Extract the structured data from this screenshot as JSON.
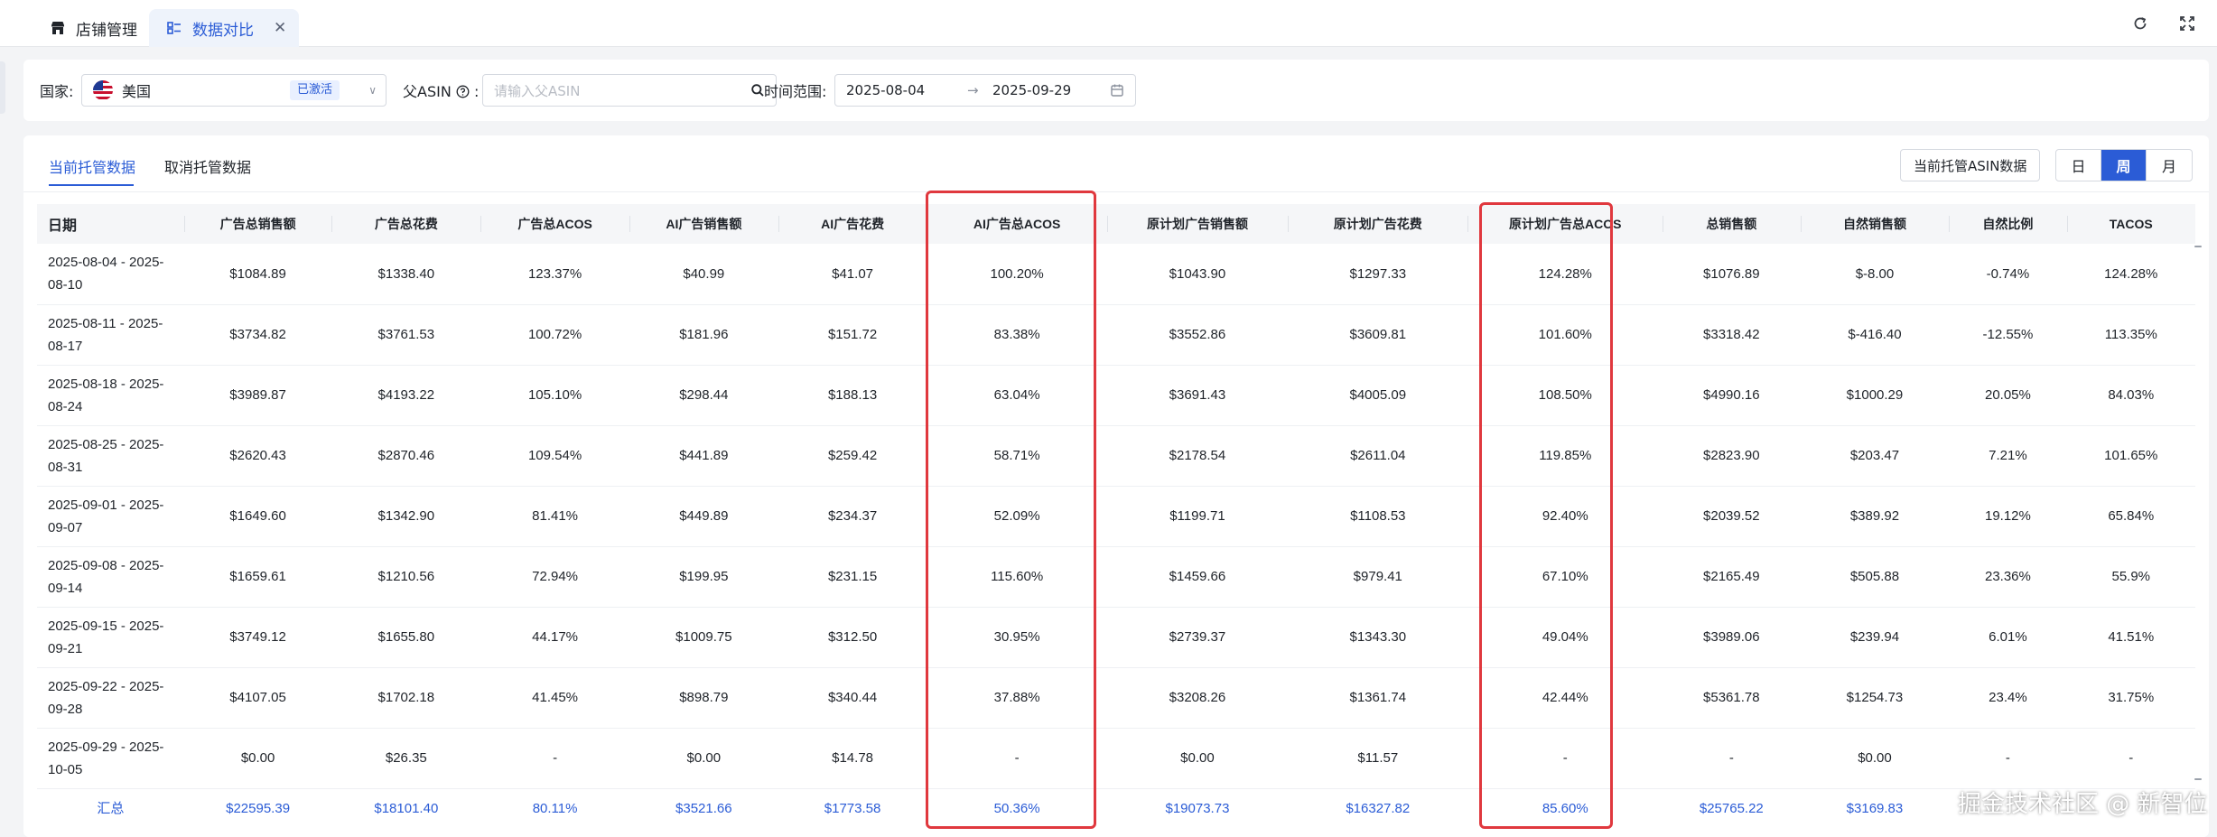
{
  "tabs": [
    {
      "label": "店铺管理",
      "icon": "store-icon",
      "active": false
    },
    {
      "label": "数据对比",
      "icon": "data-compare-icon",
      "active": true
    }
  ],
  "filters": {
    "country_label": "国家:",
    "country_value": "美国",
    "country_status": "已激活",
    "asin_label": "父ASIN",
    "asin_placeholder": "请输入父ASIN",
    "time_label": "时间范围:",
    "date_start": "2025-08-04",
    "date_end": "2025-09-29"
  },
  "subtabs": {
    "current": "当前托管数据",
    "cancelled": "取消托管数据"
  },
  "toolbar": {
    "asin_button": "当前托管ASIN数据",
    "periods": [
      "日",
      "周",
      "月"
    ],
    "active_period": "周"
  },
  "table": {
    "headers": [
      "日期",
      "广告总销售额",
      "广告总花费",
      "广告总ACOS",
      "AI广告销售额",
      "AI广告花费",
      "AI广告总ACOS",
      "原计划广告销售额",
      "原计划广告花费",
      "原计划广告总ACOS",
      "总销售额",
      "自然销售额",
      "自然比例",
      "TACOS"
    ],
    "rows": [
      {
        "date_a": "2025-08-04 - 2025-",
        "date_b": "08-10",
        "cells": [
          "$1084.89",
          "$1338.40",
          "123.37%",
          "$40.99",
          "$41.07",
          "100.20%",
          "$1043.90",
          "$1297.33",
          "124.28%",
          "$1076.89",
          "$-8.00",
          "-0.74%",
          "124.28%"
        ]
      },
      {
        "date_a": "2025-08-11 - 2025-",
        "date_b": "08-17",
        "cells": [
          "$3734.82",
          "$3761.53",
          "100.72%",
          "$181.96",
          "$151.72",
          "83.38%",
          "$3552.86",
          "$3609.81",
          "101.60%",
          "$3318.42",
          "$-416.40",
          "-12.55%",
          "113.35%"
        ]
      },
      {
        "date_a": "2025-08-18 - 2025-",
        "date_b": "08-24",
        "cells": [
          "$3989.87",
          "$4193.22",
          "105.10%",
          "$298.44",
          "$188.13",
          "63.04%",
          "$3691.43",
          "$4005.09",
          "108.50%",
          "$4990.16",
          "$1000.29",
          "20.05%",
          "84.03%"
        ]
      },
      {
        "date_a": "2025-08-25 - 2025-",
        "date_b": "08-31",
        "cells": [
          "$2620.43",
          "$2870.46",
          "109.54%",
          "$441.89",
          "$259.42",
          "58.71%",
          "$2178.54",
          "$2611.04",
          "119.85%",
          "$2823.90",
          "$203.47",
          "7.21%",
          "101.65%"
        ]
      },
      {
        "date_a": "2025-09-01 - 2025-",
        "date_b": "09-07",
        "cells": [
          "$1649.60",
          "$1342.90",
          "81.41%",
          "$449.89",
          "$234.37",
          "52.09%",
          "$1199.71",
          "$1108.53",
          "92.40%",
          "$2039.52",
          "$389.92",
          "19.12%",
          "65.84%"
        ]
      },
      {
        "date_a": "2025-09-08 - 2025-",
        "date_b": "09-14",
        "cells": [
          "$1659.61",
          "$1210.56",
          "72.94%",
          "$199.95",
          "$231.15",
          "115.60%",
          "$1459.66",
          "$979.41",
          "67.10%",
          "$2165.49",
          "$505.88",
          "23.36%",
          "55.9%"
        ]
      },
      {
        "date_a": "2025-09-15 - 2025-",
        "date_b": "09-21",
        "cells": [
          "$3749.12",
          "$1655.80",
          "44.17%",
          "$1009.75",
          "$312.50",
          "30.95%",
          "$2739.37",
          "$1343.30",
          "49.04%",
          "$3989.06",
          "$239.94",
          "6.01%",
          "41.51%"
        ]
      },
      {
        "date_a": "2025-09-22 - 2025-",
        "date_b": "09-28",
        "cells": [
          "$4107.05",
          "$1702.18",
          "41.45%",
          "$898.79",
          "$340.44",
          "37.88%",
          "$3208.26",
          "$1361.74",
          "42.44%",
          "$5361.78",
          "$1254.73",
          "23.4%",
          "31.75%"
        ]
      },
      {
        "date_a": "2025-09-29 - 2025-",
        "date_b": "10-05",
        "cells": [
          "$0.00",
          "$26.35",
          "-",
          "$0.00",
          "$14.78",
          "-",
          "$0.00",
          "$11.57",
          "-",
          "-",
          "$0.00",
          "-",
          "-"
        ]
      }
    ],
    "summary": {
      "label": "汇总",
      "cells": [
        "$22595.39",
        "$18101.40",
        "80.11%",
        "$3521.66",
        "$1773.58",
        "50.36%",
        "$19073.73",
        "$16327.82",
        "85.60%",
        "$25765.22",
        "$3169.83",
        "",
        ""
      ]
    }
  },
  "watermark": "掘金技术社区 @ 新智位",
  "colors": {
    "accent": "#2b5cd6",
    "highlight": "#e0383e",
    "header_bg": "#f5f6f8"
  }
}
